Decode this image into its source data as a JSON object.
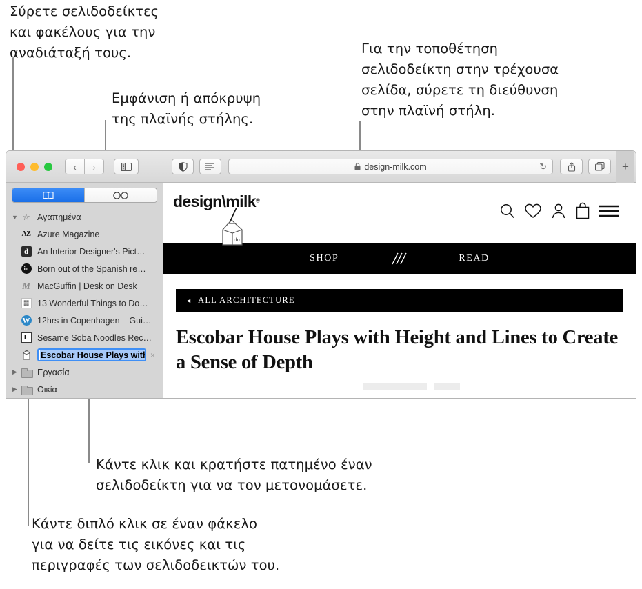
{
  "callouts": {
    "drag": "Σύρετε σελιδοδείκτες\nκαι φακέλους για την\nαναδιάταξή τους.",
    "sidebar_toggle": "Εμφάνιση ή απόκρυψη\nτης πλαϊνής στήλης.",
    "address_drag": "Για την τοποθέτηση\nσελιδοδείκτη στην τρέχουσα\nσελίδα, σύρετε τη διεύθυνση\nστην πλαϊνή στήλη.",
    "rename": "Κάντε κλικ και κρατήστε πατημένο έναν\nσελιδοδείκτη για να τον μετονομάσετε.",
    "double_click": "Κάντε διπλό κλικ σε έναν φάκελο\nγια να δείτε τις εικόνες και τις\nπεριγραφές των σελιδοδεικτών του."
  },
  "toolbar": {
    "back_glyph": "‹",
    "forward_glyph": "›",
    "sidebar_icon": "sidebar-icon",
    "reader_icon": "contrast-icon",
    "reader_list_icon": "reader-icon",
    "share_icon": "share-icon",
    "tabs_icon": "tab-overview-icon",
    "new_tab_glyph": "+"
  },
  "url_bar": {
    "lock_glyph": "🔒",
    "url": "design-milk.com",
    "reload_glyph": "↻"
  },
  "sidebar": {
    "segments": [
      {
        "name": "bookmarks",
        "icon": "book-icon",
        "active": true
      },
      {
        "name": "reading-list",
        "icon": "glasses-icon",
        "active": false
      }
    ],
    "favorites_group": "Αγαπημένα",
    "bookmarks": [
      {
        "label": "Azure Magazine",
        "favicon": "AZ",
        "kind": "az"
      },
      {
        "label": "An Interior Designer's Pict…",
        "favicon": "d",
        "kind": "dd"
      },
      {
        "label": "Born out of the Spanish re…",
        "favicon": "in",
        "kind": "dk"
      },
      {
        "label": "MacGuffin | Desk on Desk",
        "favicon": "M",
        "kind": "mg"
      },
      {
        "label": "13 Wonderful Things to Do…",
        "favicon": "▦",
        "kind": "grid"
      },
      {
        "label": "12hrs in Copenhagen – Gui…",
        "favicon": "W",
        "kind": "wp"
      },
      {
        "label": "Sesame Soba Noodles Rec…",
        "favicon": "L",
        "kind": "ll"
      }
    ],
    "editing_bookmark": {
      "text": "Escobar House Plays with",
      "favicon": "milk-carton-icon",
      "delete_glyph": "×"
    },
    "folders": [
      {
        "label": "Εργασία",
        "expanded": false
      },
      {
        "label": "Οικία",
        "expanded": false
      }
    ]
  },
  "site": {
    "logo_main": "design\\milk",
    "logo_registered": "®",
    "carton_label": "dm",
    "header_icons": [
      "search-icon",
      "heart-icon",
      "account-icon",
      "bag-icon",
      "menu-icon"
    ],
    "nav": [
      "SHOP",
      "READ"
    ],
    "nav_divider_icon": "slashes-icon",
    "category_bar": "ALL ARCHITECTURE",
    "category_arrow": "◄",
    "headline": "Escobar House Plays with Height and Lines to Create a Sense of Depth"
  },
  "colors": {
    "accent_blue": "#2b7ef0",
    "selection_blue": "#a8caf8",
    "sidebar_bg": "#d6d6d6",
    "toolbar_bg": "#e3e3e3",
    "leader_line": "#8a8a8a",
    "black_bar": "#000000"
  }
}
